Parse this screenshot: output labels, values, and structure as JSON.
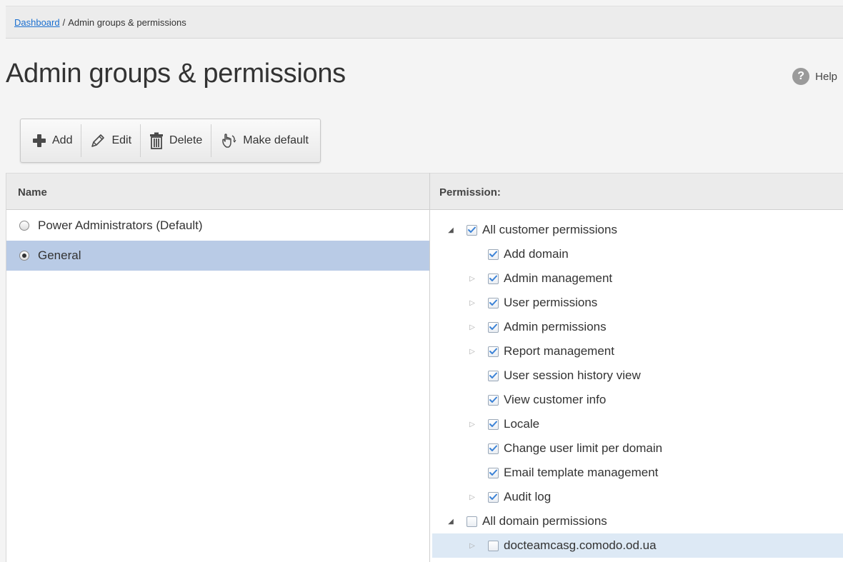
{
  "breadcrumb": {
    "link": "Dashboard",
    "separator": "/",
    "current": "Admin groups & permissions"
  },
  "page_title": "Admin groups & permissions",
  "help_label": "Help",
  "toolbar": {
    "add": "Add",
    "edit": "Edit",
    "delete": "Delete",
    "make_default": "Make default"
  },
  "table": {
    "col_name": "Name",
    "col_permission": "Permission:"
  },
  "groups": [
    {
      "label": "Power Administrators (Default)",
      "selected": false
    },
    {
      "label": "General",
      "selected": true
    }
  ],
  "permissions": [
    {
      "label": "All customer permissions",
      "level": 0,
      "toggle": "expanded",
      "checked": true
    },
    {
      "label": "Add domain",
      "level": 1,
      "toggle": "none",
      "checked": true
    },
    {
      "label": "Admin management",
      "level": 1,
      "toggle": "collapsed",
      "checked": true
    },
    {
      "label": "User permissions",
      "level": 1,
      "toggle": "collapsed",
      "checked": true
    },
    {
      "label": "Admin permissions",
      "level": 1,
      "toggle": "collapsed",
      "checked": true
    },
    {
      "label": "Report management",
      "level": 1,
      "toggle": "collapsed",
      "checked": true
    },
    {
      "label": "User session history view",
      "level": 1,
      "toggle": "none",
      "checked": true
    },
    {
      "label": "View customer info",
      "level": 1,
      "toggle": "none",
      "checked": true
    },
    {
      "label": "Locale",
      "level": 1,
      "toggle": "collapsed",
      "checked": true
    },
    {
      "label": "Change user limit per domain",
      "level": 1,
      "toggle": "none",
      "checked": true
    },
    {
      "label": "Email template management",
      "level": 1,
      "toggle": "none",
      "checked": true
    },
    {
      "label": "Audit log",
      "level": 1,
      "toggle": "collapsed",
      "checked": true
    },
    {
      "label": "All domain permissions",
      "level": 0,
      "toggle": "expanded",
      "checked": false
    },
    {
      "label": "docteamcasg.comodo.od.ua",
      "level": 1,
      "toggle": "collapsed",
      "checked": false,
      "highlight": true
    }
  ]
}
